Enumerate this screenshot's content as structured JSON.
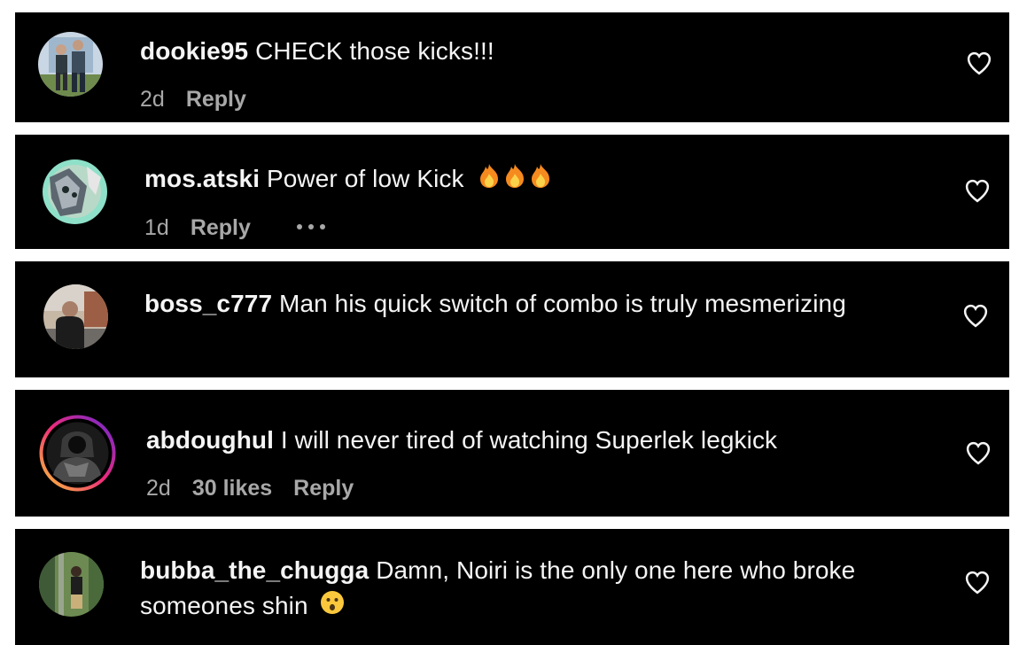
{
  "colors": {
    "background": "#ffffff",
    "card": "#000000",
    "text": "#f5f5f5",
    "meta_text": "#a8a8a8",
    "story_ring": [
      "#f9ce34",
      "#ee2a7b",
      "#6228d7"
    ]
  },
  "comments": [
    {
      "username": "dookie95",
      "text": "CHECK those kicks!!!",
      "time": "2d",
      "likes": "",
      "reply": "Reply",
      "emoji": "",
      "more_icon": false,
      "heart_icon": "heart-outline-icon"
    },
    {
      "username": "mos.atski",
      "text": "Power of low Kick",
      "time": "1d",
      "likes": "",
      "reply": "Reply",
      "emoji": "🔥🔥🔥",
      "more_icon": true,
      "heart_icon": "heart-outline-icon"
    },
    {
      "username": "boss_c777",
      "text": "Man his quick switch of combo is truly mesmerizing",
      "time": "",
      "likes": "",
      "reply": "",
      "emoji": "",
      "more_icon": false,
      "heart_icon": "heart-outline-icon"
    },
    {
      "username": "abdoughul",
      "text": "I will never tired of watching Superlek legkick",
      "time": "2d",
      "likes": "30 likes",
      "reply": "Reply",
      "emoji": "",
      "more_icon": false,
      "heart_icon": "heart-outline-icon"
    },
    {
      "username": "bubba_the_chugga",
      "text": "Damn, Noiri is the only one here who broke someones shin",
      "time": "",
      "likes": "",
      "reply": "",
      "emoji": "😮",
      "more_icon": false,
      "heart_icon": "heart-outline-icon"
    }
  ]
}
